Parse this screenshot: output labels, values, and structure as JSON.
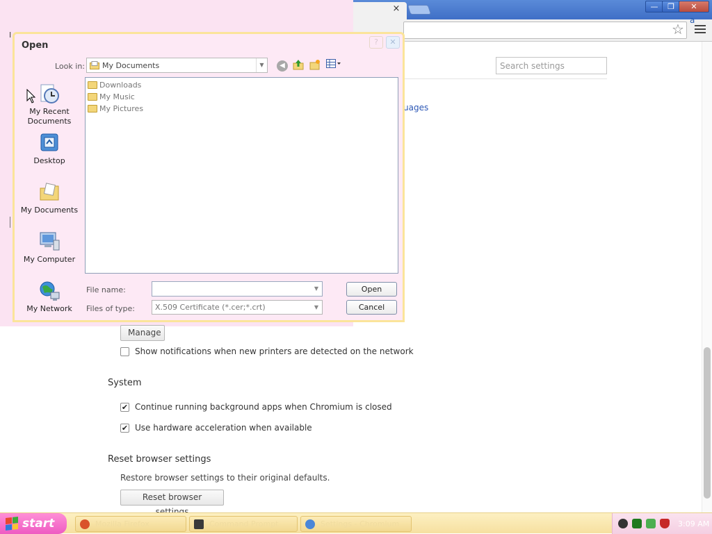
{
  "browser": {
    "tab_close": "×",
    "window_controls": {
      "minimize": "—",
      "restore": "❐",
      "close": "✕"
    },
    "extension_badge": "a",
    "star_glyph": "☆"
  },
  "settings": {
    "search": {
      "placeholder": "Search settings"
    },
    "languages_link": "uages",
    "manage_label": "Manage",
    "printers_notify": "Show notifications when new printers are detected on the network",
    "system_heading": "System",
    "background_apps": "Continue running background apps when Chromium is closed",
    "hw_accel": "Use hardware acceleration when available",
    "reset_heading": "Reset browser settings",
    "reset_desc": "Restore browser settings to their original defaults.",
    "reset_button": "Reset browser settings",
    "checkboxes": {
      "printers": false,
      "background_apps": true,
      "hw_accel": true
    },
    "stray_char": "I"
  },
  "dialog": {
    "title": "Open",
    "look_in_label": "Look in:",
    "look_in_value": "My Documents",
    "files": [
      {
        "name": "Downloads",
        "icon": "folder-icon"
      },
      {
        "name": "My Music",
        "icon": "music-folder-icon"
      },
      {
        "name": "My Pictures",
        "icon": "pictures-folder-icon"
      }
    ],
    "places": [
      {
        "label": "My Recent Documents",
        "icon": "recent-documents-icon"
      },
      {
        "label": "Desktop",
        "icon": "desktop-icon"
      },
      {
        "label": "My Documents",
        "icon": "my-documents-icon"
      },
      {
        "label": "My Computer",
        "icon": "my-computer-icon"
      },
      {
        "label": "My Network",
        "icon": "my-network-icon"
      }
    ],
    "file_name_label": "File name:",
    "file_name_value": "",
    "files_of_type_label": "Files of type:",
    "files_of_type_value": "X.509 Certificate (*.cer;*.crt)",
    "open_button": "Open",
    "cancel_button": "Cancel"
  },
  "taskbar": {
    "start_label": "start",
    "tasks": [
      {
        "label": "Mozilla Firefox",
        "icon": "firefox-icon",
        "color": "#d9532b"
      },
      {
        "label": "Command Prompt",
        "icon": "terminal-icon",
        "color": "#3a3a3a"
      },
      {
        "label": "Settings - Chromium",
        "icon": "chromium-icon",
        "color": "#4a86d8"
      }
    ],
    "clock": "3:09 AM"
  },
  "colors": {
    "dialog_bg": "#fde9f5",
    "dialog_border": "#fbe49a",
    "start_button": "#ee5bc2",
    "link": "#2c57b5"
  }
}
